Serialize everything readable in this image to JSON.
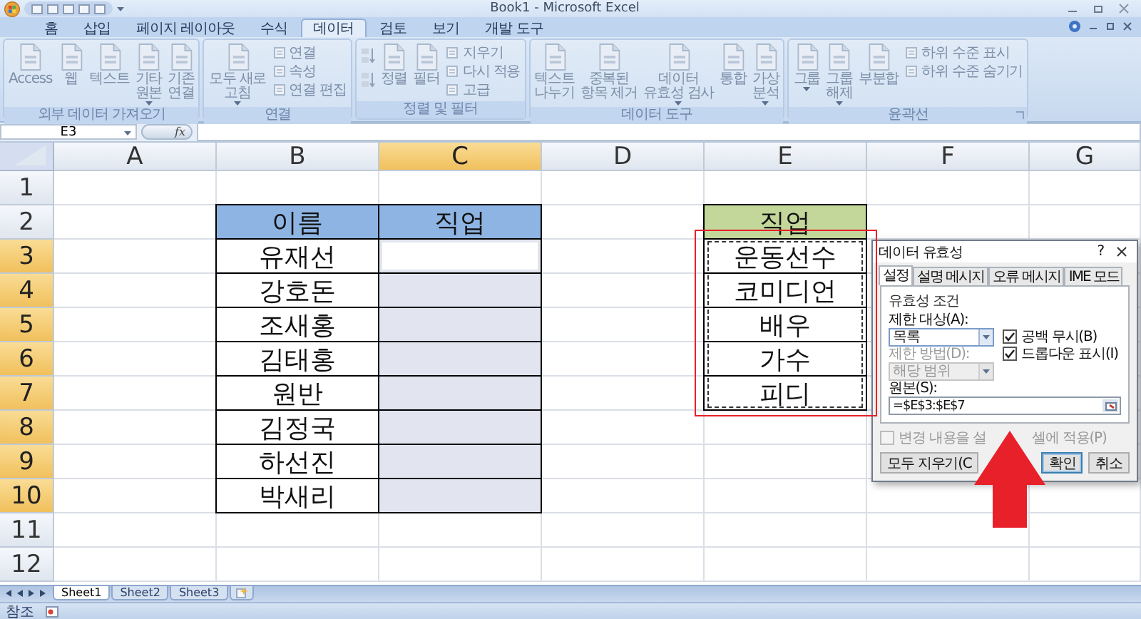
{
  "window": {
    "title": "Book1 - Microsoft Excel"
  },
  "ribbon_tabs": [
    {
      "label": "홈",
      "selected": false
    },
    {
      "label": "삽입",
      "selected": false
    },
    {
      "label": "페이지 레이아웃",
      "selected": false
    },
    {
      "label": "수식",
      "selected": false
    },
    {
      "label": "데이터",
      "selected": true
    },
    {
      "label": "검토",
      "selected": false
    },
    {
      "label": "보기",
      "selected": false
    },
    {
      "label": "개발 도구",
      "selected": false
    }
  ],
  "ribbon_groups": [
    {
      "caption": "외부 데이터 가져오기",
      "launcher": false,
      "items": [
        {
          "kind": "large",
          "label": [
            "Access"
          ],
          "dropdown": false
        },
        {
          "kind": "large",
          "label": [
            "웹"
          ],
          "dropdown": false
        },
        {
          "kind": "large",
          "label": [
            "텍스트"
          ],
          "dropdown": false
        },
        {
          "kind": "large",
          "label": [
            "기타",
            "원본"
          ],
          "dropdown": true
        },
        {
          "kind": "large",
          "label": [
            "기존",
            "연결"
          ],
          "dropdown": false
        }
      ]
    },
    {
      "caption": "연결",
      "launcher": false,
      "items": [
        {
          "kind": "large",
          "label": [
            "모두 새로",
            "고침"
          ],
          "dropdown": true
        },
        {
          "kind": "small",
          "labels": [
            "연결",
            "속성",
            "연결 편집"
          ]
        }
      ]
    },
    {
      "caption": "정렬 및 필터",
      "launcher": false,
      "items": [
        {
          "kind": "sort_pair"
        },
        {
          "kind": "large",
          "label": [
            "정렬"
          ],
          "dropdown": false
        },
        {
          "kind": "large",
          "label": [
            "필터"
          ],
          "dropdown": false
        },
        {
          "kind": "small",
          "labels": [
            "지우기",
            "다시 적용",
            "고급"
          ]
        }
      ]
    },
    {
      "caption": "데이터 도구",
      "launcher": false,
      "items": [
        {
          "kind": "large",
          "label": [
            "텍스트",
            "나누기"
          ],
          "dropdown": false
        },
        {
          "kind": "large",
          "label": [
            "중복된",
            "항목 제거"
          ],
          "dropdown": false
        },
        {
          "kind": "large",
          "label": [
            "데이터",
            "유효성 검사"
          ],
          "dropdown": true
        },
        {
          "kind": "large",
          "label": [
            "통합"
          ],
          "dropdown": false
        },
        {
          "kind": "large",
          "label": [
            "가상",
            "분석"
          ],
          "dropdown": true
        }
      ]
    },
    {
      "caption": "윤곽선",
      "launcher": true,
      "items": [
        {
          "kind": "large",
          "label": [
            "그룹"
          ],
          "dropdown": true
        },
        {
          "kind": "large",
          "label": [
            "그룹",
            "해제"
          ],
          "dropdown": true
        },
        {
          "kind": "large",
          "label": [
            "부분합"
          ],
          "dropdown": false
        },
        {
          "kind": "small",
          "labels": [
            "하위 수준 표시",
            "하위 수준 숨기기"
          ]
        }
      ]
    }
  ],
  "name_box": "E3",
  "formula_button": "fx",
  "columns": [
    {
      "label": "A",
      "selected": false
    },
    {
      "label": "B",
      "selected": false
    },
    {
      "label": "C",
      "selected": true
    },
    {
      "label": "D",
      "selected": false
    },
    {
      "label": "E",
      "selected": false
    },
    {
      "label": "F",
      "selected": false
    },
    {
      "label": "G",
      "selected": false
    }
  ],
  "rows": [
    {
      "label": "1",
      "selected": false,
      "cells": [
        null,
        null,
        null,
        null,
        null,
        null,
        null
      ]
    },
    {
      "label": "2",
      "selected": false,
      "cells": [
        null,
        {
          "text": "이름",
          "kind": "header",
          "color": "#8db4e2",
          "selected": false,
          "marquee": false
        },
        {
          "text": "직업",
          "kind": "header",
          "color": "#8db4e2",
          "selected": false,
          "marquee": false
        },
        null,
        {
          "text": "직업",
          "kind": "header",
          "color": "#c4d79b",
          "selected": false,
          "marquee": false
        },
        null,
        null
      ]
    },
    {
      "label": "3",
      "selected": true,
      "cells": [
        null,
        {
          "text": "유재선",
          "kind": "bordered",
          "selected": false,
          "marquee": false
        },
        {
          "kind": "bordered",
          "selected": true,
          "active": true,
          "marquee": false
        },
        null,
        {
          "text": "운동선수",
          "kind": "bordered",
          "selected": false,
          "marquee": true
        },
        null,
        null
      ]
    },
    {
      "label": "4",
      "selected": true,
      "cells": [
        null,
        {
          "text": "강호돈",
          "kind": "bordered",
          "selected": false,
          "marquee": false
        },
        {
          "kind": "bordered",
          "selected": true,
          "marquee": false
        },
        null,
        {
          "text": "코미디언",
          "kind": "bordered",
          "selected": false,
          "marquee": true
        },
        null,
        null
      ]
    },
    {
      "label": "5",
      "selected": true,
      "cells": [
        null,
        {
          "text": "조새홍",
          "kind": "bordered",
          "selected": false,
          "marquee": false
        },
        {
          "kind": "bordered",
          "selected": true,
          "marquee": false
        },
        null,
        {
          "text": "배우",
          "kind": "bordered",
          "selected": false,
          "marquee": true
        },
        null,
        null
      ]
    },
    {
      "label": "6",
      "selected": true,
      "cells": [
        null,
        {
          "text": "김태홍",
          "kind": "bordered",
          "selected": false,
          "marquee": false
        },
        {
          "kind": "bordered",
          "selected": true,
          "marquee": false
        },
        null,
        {
          "text": "가수",
          "kind": "bordered",
          "selected": false,
          "marquee": true
        },
        null,
        null
      ]
    },
    {
      "label": "7",
      "selected": true,
      "cells": [
        null,
        {
          "text": "원반",
          "kind": "bordered",
          "selected": false,
          "marquee": false
        },
        {
          "kind": "bordered",
          "selected": true,
          "marquee": false
        },
        null,
        {
          "text": "피디",
          "kind": "bordered",
          "selected": false,
          "marquee": true
        },
        null,
        null
      ]
    },
    {
      "label": "8",
      "selected": true,
      "cells": [
        null,
        {
          "text": "김정국",
          "kind": "bordered",
          "selected": false,
          "marquee": false
        },
        {
          "kind": "bordered",
          "selected": true,
          "marquee": false
        },
        null,
        null,
        null,
        null
      ]
    },
    {
      "label": "9",
      "selected": true,
      "cells": [
        null,
        {
          "text": "하선진",
          "kind": "bordered",
          "selected": false,
          "marquee": false
        },
        {
          "kind": "bordered",
          "selected": true,
          "marquee": false
        },
        null,
        null,
        null,
        null
      ]
    },
    {
      "label": "10",
      "selected": true,
      "cells": [
        null,
        {
          "text": "박새리",
          "kind": "bordered",
          "selected": false,
          "marquee": false
        },
        {
          "kind": "bordered",
          "selected": true,
          "marquee": false
        },
        null,
        null,
        null,
        null
      ]
    },
    {
      "label": "11",
      "selected": false,
      "cells": [
        null,
        null,
        null,
        null,
        null,
        null,
        null
      ]
    },
    {
      "label": "12",
      "selected": false,
      "cells": [
        null,
        null,
        null,
        null,
        null,
        null,
        null
      ]
    }
  ],
  "dialog": {
    "title": "데이터 유효성",
    "help": "?",
    "tabs": [
      {
        "label": "설정",
        "selected": true
      },
      {
        "label": "설명 메시지",
        "selected": false
      },
      {
        "label": "오류 메시지",
        "selected": false
      },
      {
        "label": "IME 모드",
        "selected": false
      }
    ],
    "section": "유효성 조건",
    "allow": {
      "label": "제한 대상(A):",
      "value": "목록",
      "disabled": false
    },
    "data_method": {
      "label": "제한 방법(D):",
      "value": "해당 범위",
      "disabled": true
    },
    "checkboxes": [
      {
        "label": "공백 무시(B)",
        "checked": true
      },
      {
        "label": "드롭다운 표시(I)",
        "checked": true
      }
    ],
    "source": {
      "label": "원본(S):",
      "value": "=$E$3:$E$7"
    },
    "apply_all": {
      "parts": [
        "변경 내용을 설",
        "셀에 적용(P)"
      ],
      "checked": false,
      "disabled": true
    },
    "buttons": [
      {
        "label": "모두 지우기(C",
        "kind": "normal"
      },
      {
        "label": "확인",
        "kind": "default"
      },
      {
        "label": "취소",
        "kind": "normal"
      }
    ]
  },
  "sheet_tabs": [
    {
      "label": "Sheet1",
      "selected": true
    },
    {
      "label": "Sheet2",
      "selected": false
    },
    {
      "label": "Sheet3",
      "selected": false
    }
  ],
  "status_bar": {
    "mode": "참조"
  },
  "highlight_outline": {
    "color": "#e8202a"
  },
  "arrow": {
    "color": "#e8202a"
  }
}
